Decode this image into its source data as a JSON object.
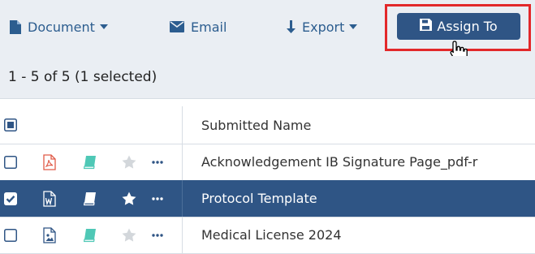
{
  "toolbar": {
    "document_label": "Document",
    "email_label": "Email",
    "export_label": "Export",
    "assign_label": "Assign To"
  },
  "pagination": {
    "summary": "1 - 5 of 5 (1 selected)"
  },
  "table": {
    "columns": [
      "Submitted Name"
    ],
    "rows": [
      {
        "name": "Acknowledgement IB Signature Page_pdf-r",
        "file_type": "pdf",
        "selected": false,
        "starred": false
      },
      {
        "name": "Protocol Template",
        "file_type": "word",
        "selected": true,
        "starred": true
      },
      {
        "name": "Medical License 2024",
        "file_type": "image",
        "selected": false,
        "starred": false
      }
    ]
  },
  "colors": {
    "toolbar_bg": "#eaeef3",
    "accent": "#2f5585",
    "link": "#2c5d8f",
    "highlight": "#e2282a",
    "pdf_red": "#e05a47",
    "book_teal": "#4fc8b6"
  },
  "icons": [
    "document-icon",
    "caret-down-icon",
    "email-icon",
    "arrow-down-icon",
    "save-icon",
    "hand-cursor-icon",
    "checkbox-icon",
    "pdf-file-icon",
    "word-file-icon",
    "image-file-icon",
    "book-icon",
    "star-icon",
    "more-icon"
  ]
}
